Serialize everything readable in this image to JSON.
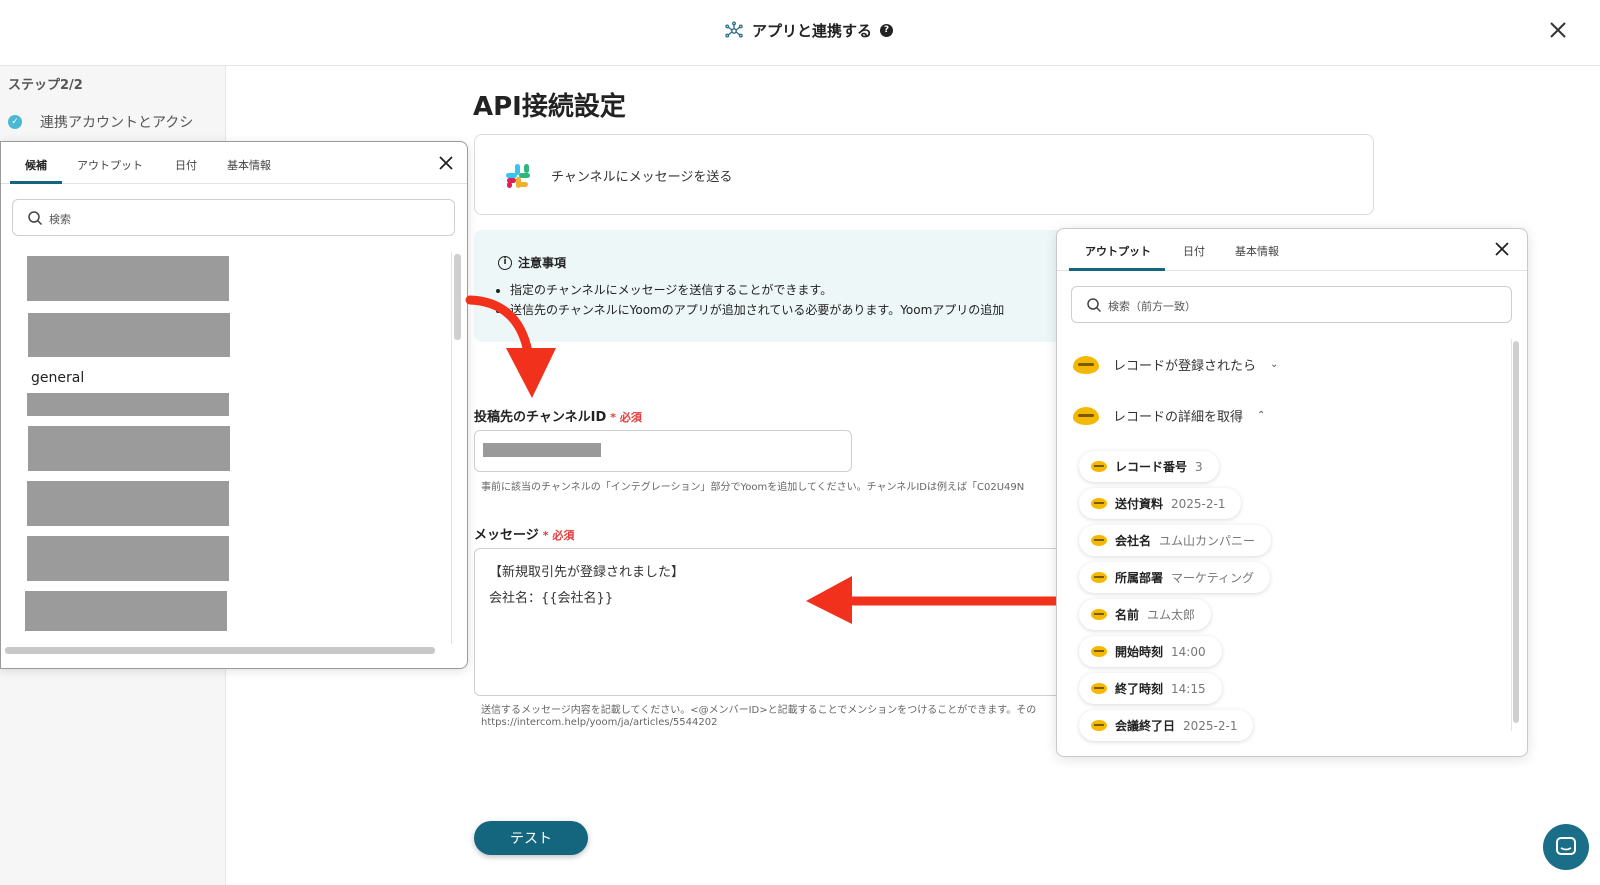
{
  "header": {
    "title": "アプリと連携する",
    "help": "?"
  },
  "steps": {
    "label": "ステップ2/2",
    "item": "連携アカウントとアクシ"
  },
  "main": {
    "title": "API接続設定",
    "action": "チャンネルにメッセージを送る",
    "notice": {
      "heading": "注意事項",
      "items": [
        "指定のチャンネルにメッセージを送信することができます。",
        "送信先のチャンネルにYoomのアプリが追加されている必要があります。Yoomアプリの追加"
      ]
    },
    "channel": {
      "label": "投稿先のチャンネルID",
      "required": "* 必須",
      "hint": "事前に該当のチャンネルの「インテグレーション」部分でYoomを追加してください。チャンネルIDは例えば「C02U49N"
    },
    "message": {
      "label": "メッセージ",
      "required": "* 必須",
      "line1": "【新規取引先が登録されました】",
      "line2": "会社名：{{会社名}}",
      "hint1": "送信するメッセージ内容を記載してください。<@メンバーID>と記載することでメンションをつけることができます。その",
      "hint2": "https://intercom.help/yoom/ja/articles/5544202"
    },
    "test_button": "テスト"
  },
  "left_picker": {
    "tabs": [
      "候補",
      "アウトプット",
      "日付",
      "基本情報"
    ],
    "search_placeholder": "検索",
    "general": "general"
  },
  "right_picker": {
    "tabs": [
      "アウトプット",
      "日付",
      "基本情報"
    ],
    "search_placeholder": "検索（前方一致）",
    "groups": [
      "レコードが登録されたら",
      "レコードの詳細を取得"
    ],
    "fields": [
      {
        "name": "レコード番号",
        "value": "3"
      },
      {
        "name": "送付資料",
        "value": "2025-2-1"
      },
      {
        "name": "会社名",
        "value": "ユム山カンパニー"
      },
      {
        "name": "所属部署",
        "value": "マーケティング"
      },
      {
        "name": "名前",
        "value": "ユム太郎"
      },
      {
        "name": "開始時刻",
        "value": "14:00"
      },
      {
        "name": "終了時刻",
        "value": "14:15"
      },
      {
        "name": "会議終了日",
        "value": "2025-2-1"
      }
    ]
  },
  "colors": {
    "accent": "#14657e",
    "required": "#e23b3b",
    "arrow": "#f2311d",
    "kintone": "#f5b800"
  }
}
